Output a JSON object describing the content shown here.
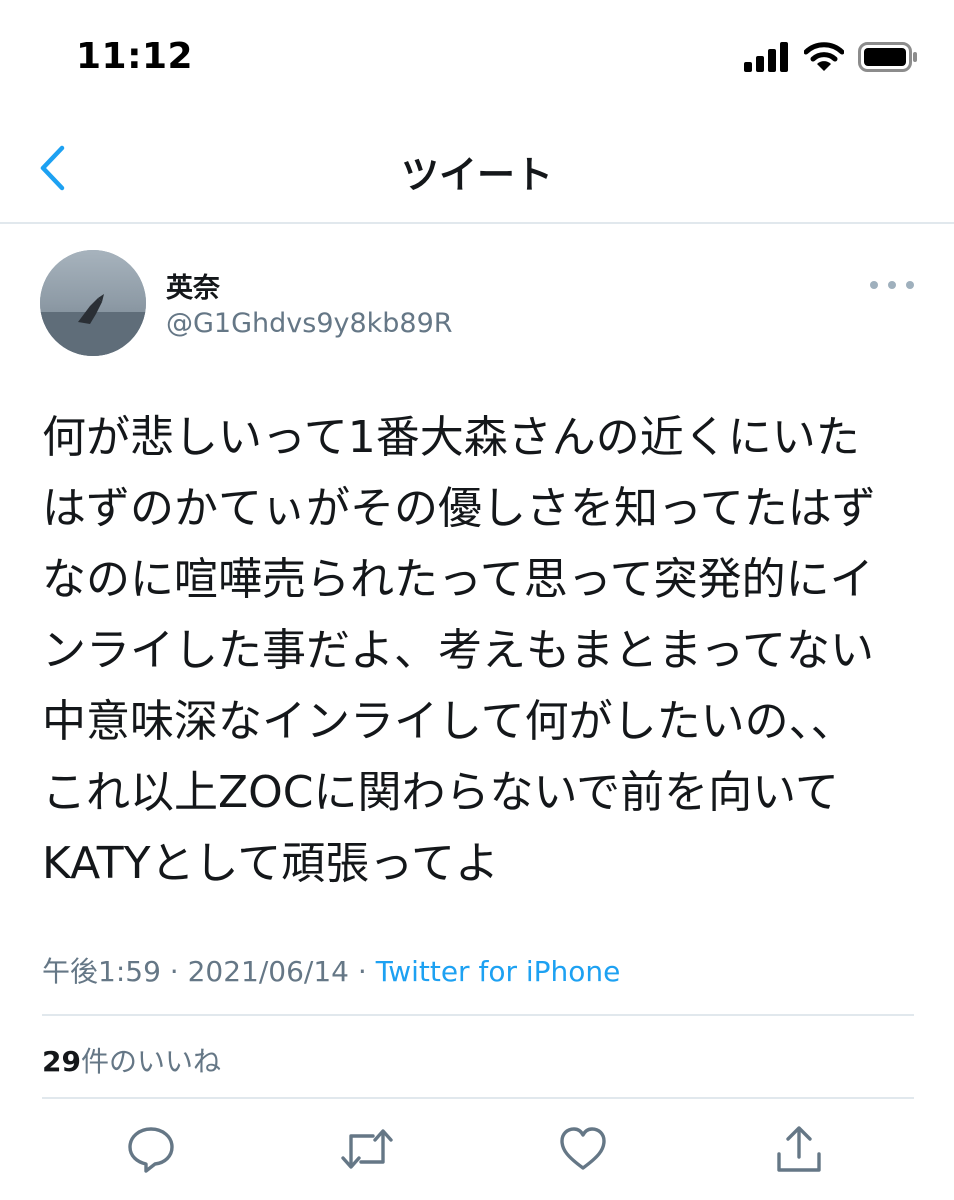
{
  "status_bar": {
    "time": "11:12"
  },
  "nav": {
    "title": "ツイート",
    "back_icon": "chevron-left-icon"
  },
  "tweet": {
    "author": {
      "display_name": "英奈",
      "handle": "@G1Ghdvs9y8kb89R"
    },
    "text_lines": [
      "何が悲しいって1番大森さんの近くにいた",
      "はずのかてぃがその優しさを知ってたはず",
      "なのに喧嘩売られたって思って突発的にイ",
      "ンライした事だよ、考えもまとまってない",
      "中意味深なインライして何がしたいの、、",
      "これ以上ZOCに関わらないで前を向いて",
      "KATYとして頑張ってよ"
    ],
    "time": "午後1:59",
    "separator": "·",
    "date": "2021/06/14",
    "source": "Twitter for iPhone",
    "likes_count": "29",
    "likes_label": "件のいいね"
  },
  "colors": {
    "accent": "#1da1f2",
    "secondary_text": "#657786",
    "divider": "#e1e8ed",
    "icon": "#657786"
  },
  "actions": [
    {
      "name": "reply",
      "icon": "comment-icon"
    },
    {
      "name": "retweet",
      "icon": "retweet-icon"
    },
    {
      "name": "like",
      "icon": "heart-icon"
    },
    {
      "name": "share",
      "icon": "share-icon"
    }
  ]
}
